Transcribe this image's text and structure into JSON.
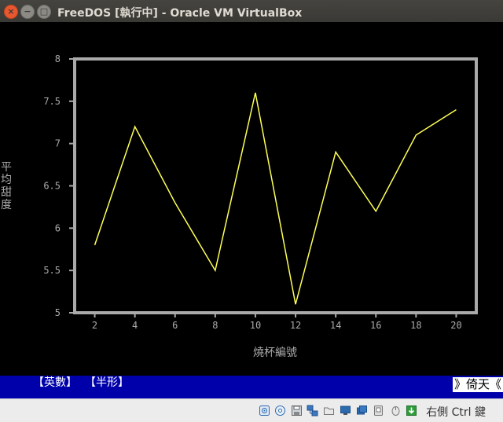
{
  "window": {
    "title": "FreeDOS [執行中] - Oracle VM VirtualBox"
  },
  "chart_data": {
    "type": "line",
    "x": [
      2,
      4,
      6,
      8,
      10,
      12,
      14,
      16,
      18,
      20
    ],
    "series": [
      {
        "values": [
          5.8,
          7.2,
          6.3,
          5.5,
          7.6,
          5.1,
          6.9,
          6.2,
          7.1,
          7.4
        ]
      }
    ],
    "xticks": [
      "2",
      "4",
      "6",
      "8",
      "10",
      "12",
      "14",
      "16",
      "18",
      "20"
    ],
    "yticks": [
      "5",
      "5.5",
      "6",
      "6.5",
      "7",
      "7.5",
      "8"
    ],
    "xlim": [
      1,
      21
    ],
    "ylim": [
      5,
      8
    ],
    "xlabel": "燒杯編號",
    "ylabel": "平均甜度",
    "grid": false,
    "colors": {
      "line": "#ffff55",
      "frame": "#aaaaaa",
      "text": "#aaaaaa"
    }
  },
  "dos_status": {
    "mode1": "【英數】",
    "mode2": "【半形】",
    "brand": "》倚天《"
  },
  "vbox_status": {
    "icons": [
      "hard-disk-icon",
      "optical-disk-icon",
      "floppy-icon",
      "network-icon",
      "shared-folder-icon",
      "display-icon",
      "video-capture-icon",
      "usb-icon",
      "mouse-integration-icon",
      "host-key-arrow-icon"
    ],
    "host_key": "右側 Ctrl 鍵"
  }
}
